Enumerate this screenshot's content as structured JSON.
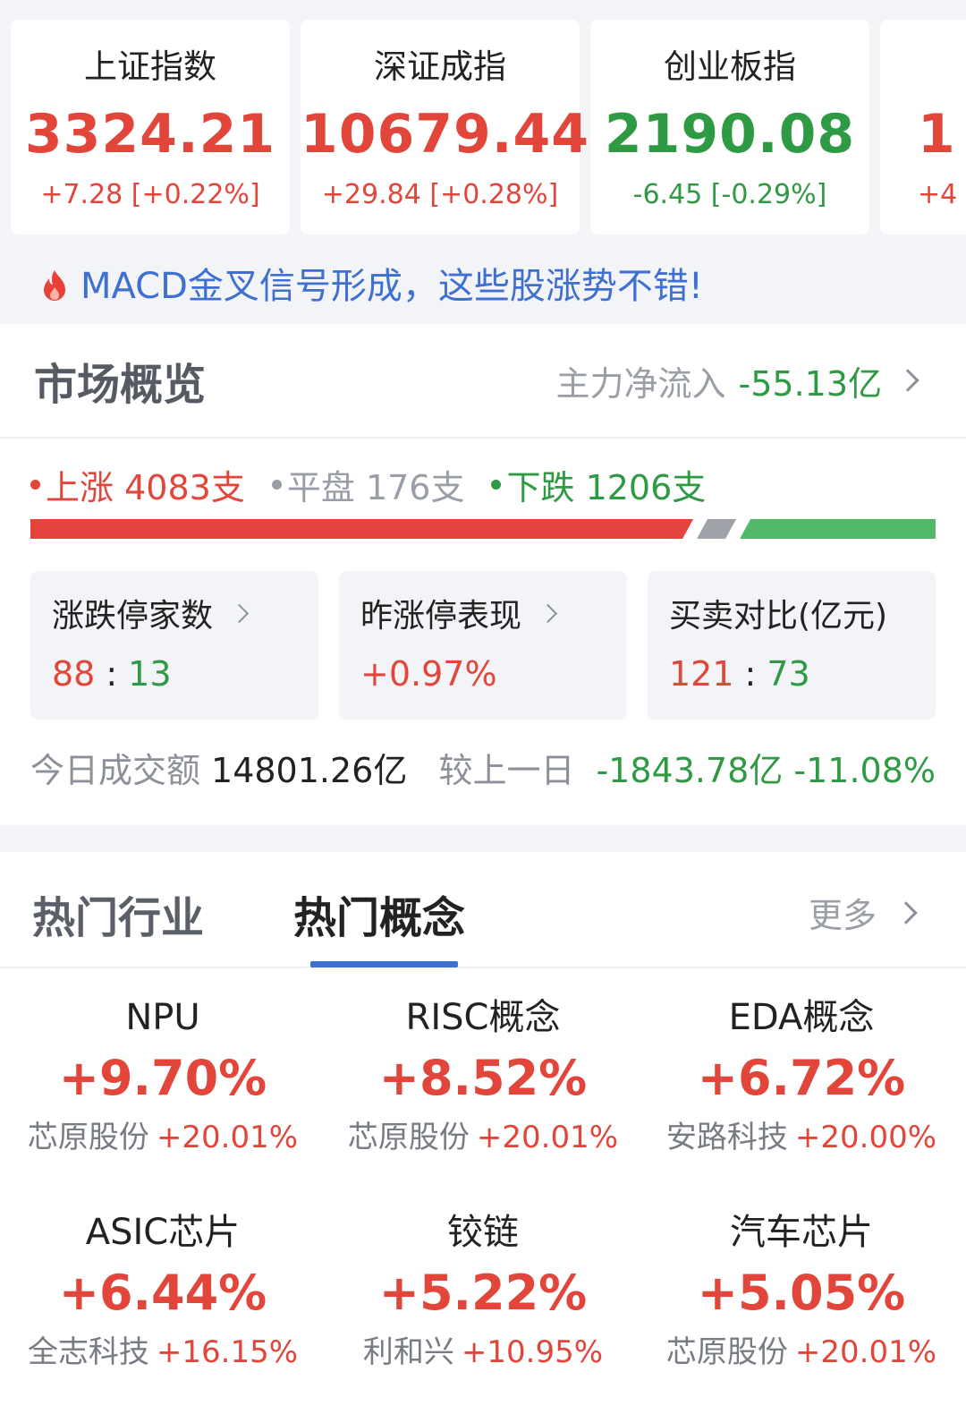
{
  "indices": [
    {
      "name": "上证指数",
      "price": "3324.21",
      "change": "+7.28 [+0.22%]",
      "trend": "up"
    },
    {
      "name": "深证成指",
      "price": "10679.44",
      "change": "+29.84 [+0.28%]",
      "trend": "up"
    },
    {
      "name": "创业板指",
      "price": "2190.08",
      "change": "-6.45 [-0.29%]",
      "trend": "down"
    },
    {
      "name": "",
      "price": "1",
      "change": "+4",
      "trend": "up"
    }
  ],
  "promo": {
    "icon": "flame-icon",
    "text": "MACD金叉信号形成，这些股涨势不错!"
  },
  "market": {
    "title": "市场概览",
    "inflow_label": "主力净流入",
    "inflow_value": "-55.13亿",
    "counts": {
      "up_label": "上涨",
      "up_value": "4083支",
      "flat_label": "平盘",
      "flat_value": "176支",
      "down_label": "下跌",
      "down_value": "1206支"
    },
    "breadth": {
      "up": 4083,
      "flat": 176,
      "down": 1206
    },
    "stats": [
      {
        "label": "涨跌停家数",
        "value_a": "88",
        "value_b": "13",
        "has_chevron": true
      },
      {
        "label": "昨涨停表现",
        "value": "+0.97%",
        "has_chevron": true
      },
      {
        "label": "买卖对比(亿元)",
        "value_a": "121",
        "value_b": "73",
        "has_chevron": false
      }
    ],
    "turnover_label": "今日成交额",
    "turnover_value": "14801.26亿",
    "compare_label": "较上一日",
    "compare_value": "-1843.78亿 -11.08%"
  },
  "hot": {
    "tab_industry": "热门行业",
    "tab_concept": "热门概念",
    "more": "更多",
    "items": [
      {
        "name": "NPU",
        "pct": "+9.70%",
        "stock": "芯原股份",
        "stock_pct": "+20.01%"
      },
      {
        "name": "RISC概念",
        "pct": "+8.52%",
        "stock": "芯原股份",
        "stock_pct": "+20.01%"
      },
      {
        "name": "EDA概念",
        "pct": "+6.72%",
        "stock": "安路科技",
        "stock_pct": "+20.00%"
      },
      {
        "name": "ASIC芯片",
        "pct": "+6.44%",
        "stock": "全志科技",
        "stock_pct": "+16.15%"
      },
      {
        "name": "铰链",
        "pct": "+5.22%",
        "stock": "利和兴",
        "stock_pct": "+10.95%"
      },
      {
        "name": "汽车芯片",
        "pct": "+5.05%",
        "stock": "芯原股份",
        "stock_pct": "+20.01%"
      }
    ]
  },
  "colors": {
    "up": "#e2463b",
    "down": "#2f9a44",
    "accent": "#3f6fd0"
  }
}
